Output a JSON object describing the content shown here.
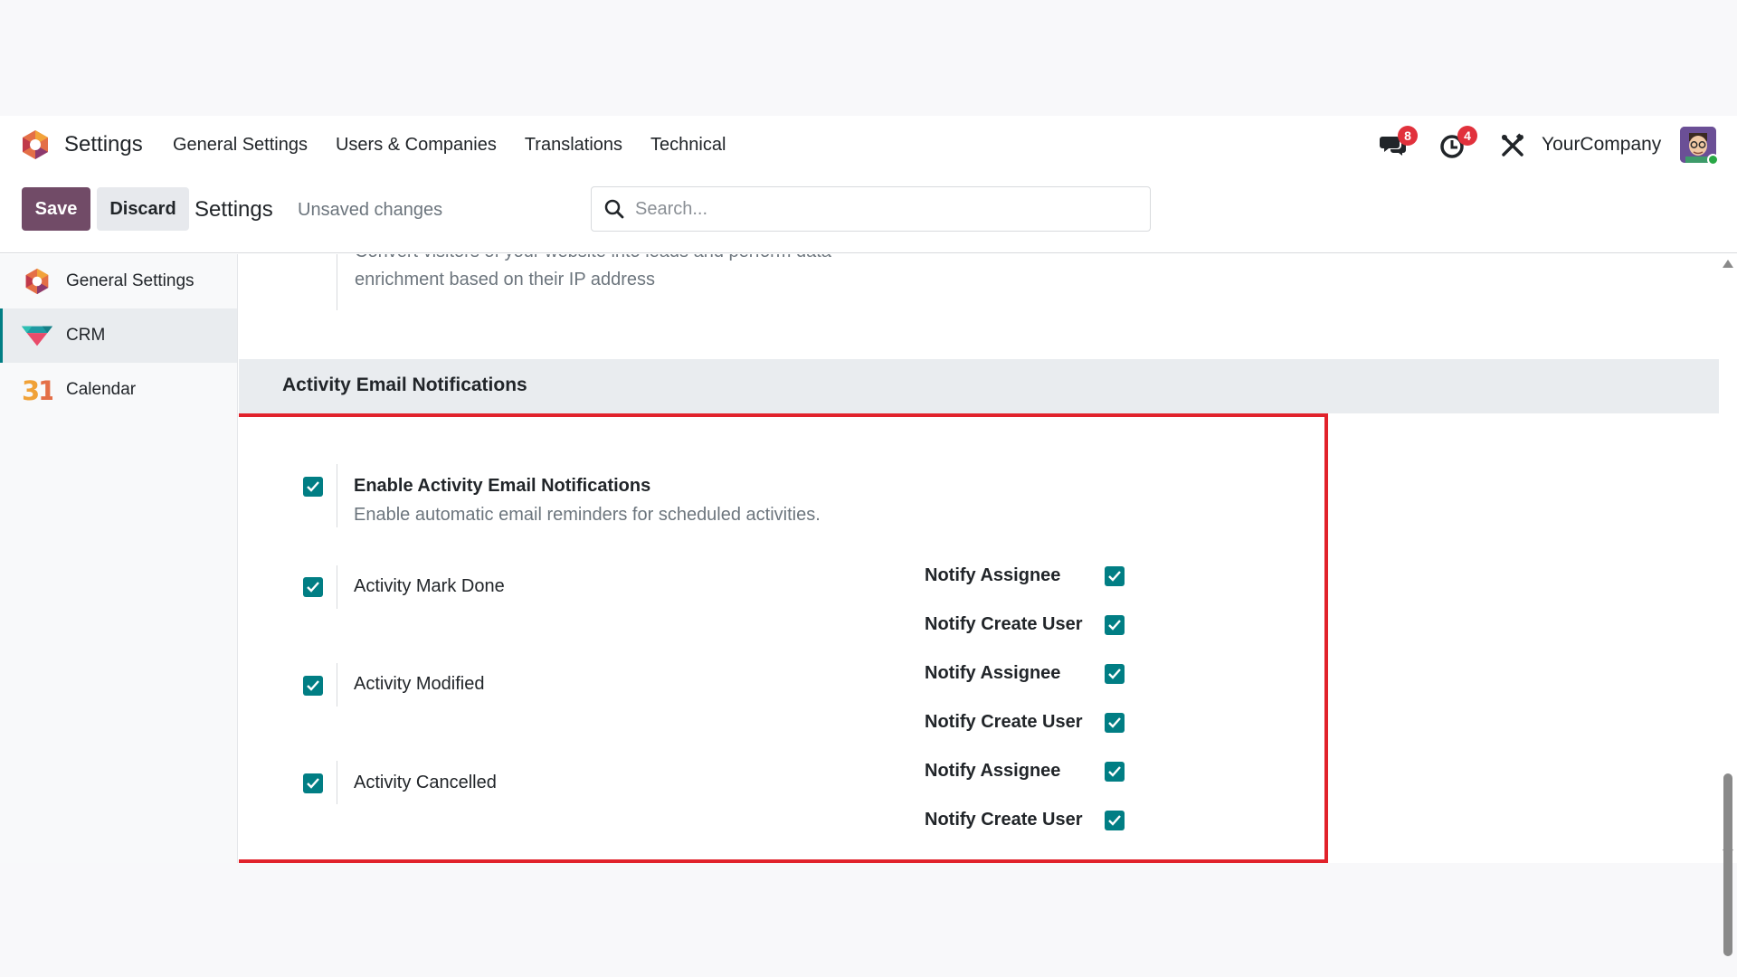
{
  "navbar": {
    "app_name": "Settings",
    "menu": [
      "General Settings",
      "Users & Companies",
      "Translations",
      "Technical"
    ],
    "messages_badge": "8",
    "activities_badge": "4",
    "company": "YourCompany"
  },
  "control_panel": {
    "save_label": "Save",
    "discard_label": "Discard",
    "title": "Settings",
    "status": "Unsaved changes",
    "search_placeholder": "Search..."
  },
  "sidebar": {
    "items": [
      {
        "label": "General Settings",
        "icon": "odoo-logo-icon",
        "active": false
      },
      {
        "label": "CRM",
        "icon": "crm-handshake-icon",
        "active": true
      },
      {
        "label": "Calendar",
        "icon": "calendar-31-icon",
        "active": false
      }
    ]
  },
  "content": {
    "previous_setting_desc_line1": "Convert visitors of your website into leads and perform data",
    "previous_setting_desc_line2": "enrichment based on their IP address",
    "section_title": "Activity Email Notifications",
    "enable_setting": {
      "title": "Enable Activity Email Notifications",
      "description": "Enable automatic email reminders for scheduled activities.",
      "checked": true
    },
    "activities": [
      {
        "label": "Activity Mark Done",
        "checked": true,
        "notify_assignee": "Notify Assignee",
        "notify_create_user": "Notify Create User"
      },
      {
        "label": "Activity Modified",
        "checked": true,
        "notify_assignee": "Notify Assignee",
        "notify_create_user": "Notify Create User"
      },
      {
        "label": "Activity Cancelled",
        "checked": true,
        "notify_assignee": "Notify Assignee",
        "notify_create_user": "Notify Create User"
      }
    ]
  },
  "colors": {
    "primary": "#714b67",
    "checkbox": "#017e84",
    "badge": "#e1313c",
    "highlight_border": "#e1222b"
  }
}
